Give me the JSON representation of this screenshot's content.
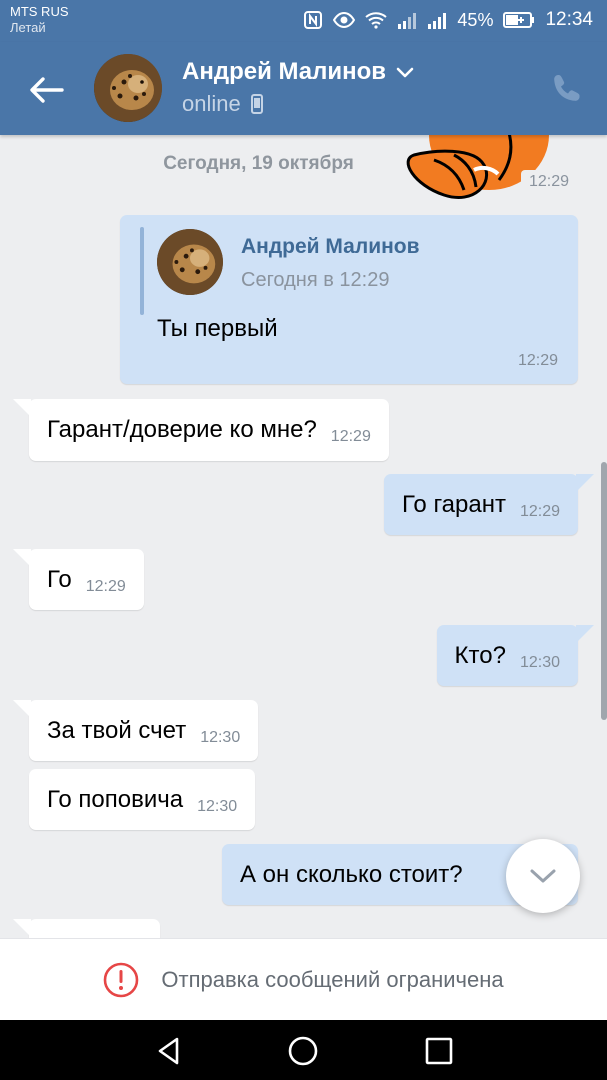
{
  "status_bar": {
    "carrier": "MTS RUS",
    "carrier_secondary": "Летай",
    "battery": "45%",
    "time": "12:34",
    "icons": [
      "nfc-icon",
      "eye-icon",
      "wifi-icon",
      "signal-icon",
      "signal-icon",
      "battery-icon"
    ]
  },
  "header": {
    "contact_name": "Андрей Малинов",
    "status": "online",
    "icons": [
      "back-arrow-icon",
      "chevron-down-icon",
      "phone-icon-small",
      "phone-call-icon"
    ]
  },
  "chat": {
    "date_separator": "Сегодня, 19 октября",
    "sticker_time": "12:29",
    "forwarded": {
      "author": "Андрей Малинов",
      "date": "Сегодня в 12:29",
      "text": "Ты первый",
      "time": "12:29"
    },
    "messages": [
      {
        "dir": "in",
        "text": "Гарант/доверие ко мне?",
        "time": "12:29"
      },
      {
        "dir": "out",
        "text": "Го гарант",
        "time": "12:29"
      },
      {
        "dir": "in",
        "text": "Го",
        "time": "12:29"
      },
      {
        "dir": "out",
        "text": "Кто?",
        "time": "12:30"
      },
      {
        "dir": "in",
        "text": "За твой счет",
        "time": "12:30"
      },
      {
        "dir": "in",
        "text": "Го поповича",
        "time": "12:30"
      },
      {
        "dir": "out",
        "text": "А он сколько стоит?",
        "time": ""
      }
    ]
  },
  "restriction": {
    "text": "Отправка сообщений ограничена",
    "icon": "alert-circle-icon",
    "icon_color": "#e64646"
  },
  "colors": {
    "header": "#4a76a8",
    "incoming_bubble": "#ffffff",
    "outgoing_bubble": "#cfe1f6",
    "background": "#edeef0"
  }
}
